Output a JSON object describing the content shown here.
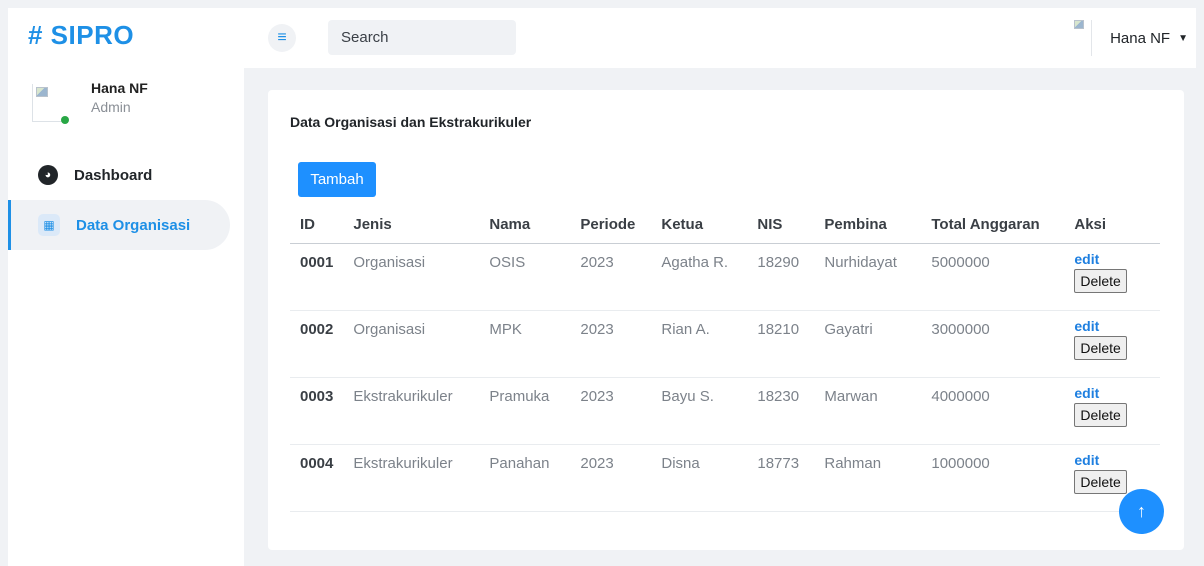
{
  "brand": "# SIPRO",
  "profile": {
    "name": "Hana NF",
    "role": "Admin"
  },
  "nav": [
    {
      "label": "Dashboard",
      "icon": "speedometer-icon"
    },
    {
      "label": "Data Organisasi",
      "icon": "table-icon",
      "active": true
    }
  ],
  "topbar": {
    "search_placeholder": "Search",
    "user_name": "Hana NF"
  },
  "card": {
    "title": "Data Organisasi dan Ekstrakurikuler",
    "add_label": "Tambah",
    "columns": [
      "ID",
      "Jenis",
      "Nama",
      "Periode",
      "Ketua",
      "NIS",
      "Pembina",
      "Total Anggaran",
      "Aksi"
    ],
    "rows": [
      [
        "0001",
        "Organisasi",
        "OSIS",
        "2023",
        "Agatha R.",
        "18290",
        "Nurhidayat",
        "5000000"
      ],
      [
        "0002",
        "Organisasi",
        "MPK",
        "2023",
        "Rian A.",
        "18210",
        "Gayatri",
        "3000000"
      ],
      [
        "0003",
        "Ekstrakurikuler",
        "Pramuka",
        "2023",
        "Bayu S.",
        "18230",
        "Marwan",
        "4000000"
      ],
      [
        "0004",
        "Ekstrakurikuler",
        "Panahan",
        "2023",
        "Disna",
        "18773",
        "Rahman",
        "1000000"
      ]
    ],
    "edit_label": "edit",
    "delete_label": "Delete"
  },
  "colors": {
    "accent": "#1e90ff",
    "brand": "#1e90e6",
    "online": "#28a745"
  }
}
